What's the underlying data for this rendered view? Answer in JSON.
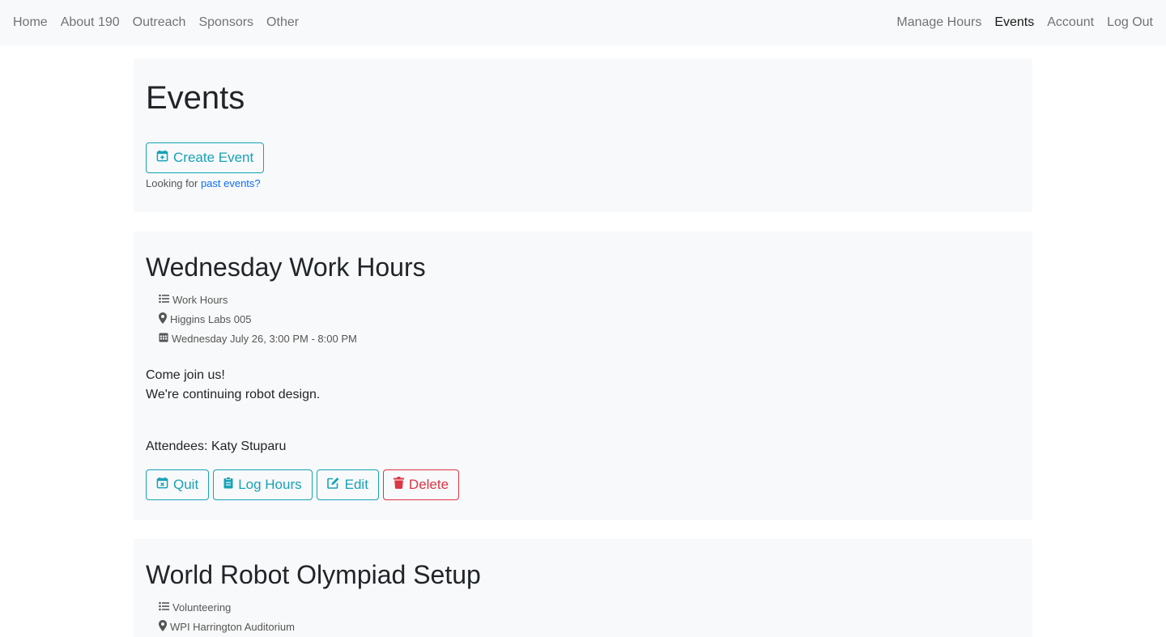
{
  "nav": {
    "left": [
      "Home",
      "About 190",
      "Outreach",
      "Sponsors",
      "Other"
    ],
    "right": [
      "Manage Hours",
      "Events",
      "Account",
      "Log Out"
    ]
  },
  "header": {
    "title": "Events",
    "create_button": "Create Event",
    "past_prefix": "Looking for ",
    "past_link": "past events?"
  },
  "events": [
    {
      "title": "Wednesday Work Hours",
      "type": "Work Hours",
      "location": "Higgins Labs 005",
      "datetime": "Wednesday July 26, 3:00 PM - 8:00 PM",
      "description_line1": "Come join us!",
      "description_line2": "We're continuing robot design.",
      "attendees": "Attendees: Katy Stuparu",
      "buttons": {
        "quit": "Quit",
        "log_hours": "Log Hours",
        "edit": "Edit",
        "delete": "Delete"
      }
    },
    {
      "title": "World Robot Olympiad Setup",
      "type": "Volunteering",
      "location": "WPI Harrington Auditorium"
    }
  ],
  "colors": {
    "info": "#17a2b8",
    "danger": "#dc3545",
    "link": "#0d6efd",
    "card_bg": "#f8f9fa"
  }
}
